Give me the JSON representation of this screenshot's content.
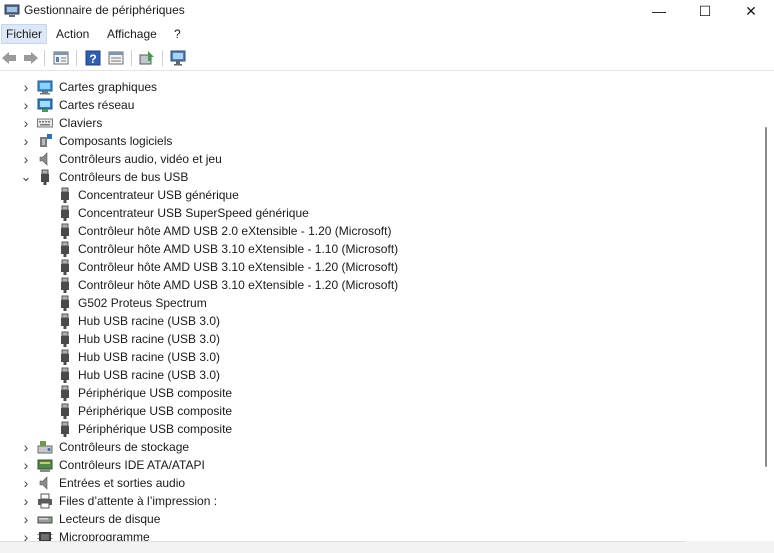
{
  "window": {
    "title": "Gestionnaire de périphériques",
    "minimize_glyph": "—",
    "maximize_glyph": "☐",
    "close_glyph": "✕"
  },
  "menu": [
    {
      "label": "Fichier",
      "active": true
    },
    {
      "label": "Action",
      "active": false
    },
    {
      "label": "Affichage",
      "active": false
    },
    {
      "label": "?",
      "active": false
    }
  ],
  "toolbar": {
    "back_icon": "arrow-left-icon",
    "forward_icon": "arrow-right-icon",
    "buttons": [
      "properties-icon",
      "help-icon",
      "view-icon",
      "update-driver-icon",
      "scan-hardware-icon"
    ]
  },
  "tree": {
    "categories_top": [
      {
        "label": "Cartes graphiques",
        "icon": "display-adapter-icon",
        "expanded": false
      },
      {
        "label": "Cartes réseau",
        "icon": "network-adapter-icon",
        "expanded": false
      },
      {
        "label": "Claviers",
        "icon": "keyboard-icon",
        "expanded": false
      },
      {
        "label": "Composants logiciels",
        "icon": "software-component-icon",
        "expanded": false
      },
      {
        "label": "Contrôleurs audio, vidéo et jeu",
        "icon": "speaker-icon",
        "expanded": false
      },
      {
        "label": "Contrôleurs de bus USB",
        "icon": "usb-icon",
        "expanded": true
      }
    ],
    "usb_children": [
      "Concentrateur USB générique",
      "Concentrateur USB SuperSpeed générique",
      "Contrôleur hôte AMD USB 2.0 eXtensible - 1.20 (Microsoft)",
      "Contrôleur hôte AMD USB 3.10 eXtensible - 1.10 (Microsoft)",
      "Contrôleur hôte AMD USB 3.10 eXtensible - 1.20 (Microsoft)",
      "Contrôleur hôte AMD USB 3.10 eXtensible - 1.20 (Microsoft)",
      "G502 Proteus Spectrum",
      "Hub USB racine (USB 3.0)",
      "Hub USB racine (USB 3.0)",
      "Hub USB racine (USB 3.0)",
      "Hub USB racine (USB 3.0)",
      "Périphérique USB composite",
      "Périphérique USB composite",
      "Périphérique USB composite"
    ],
    "categories_bottom": [
      {
        "label": "Contrôleurs de stockage",
        "icon": "storage-controller-icon",
        "expanded": false
      },
      {
        "label": "Contrôleurs IDE ATA/ATAPI",
        "icon": "ide-controller-icon",
        "expanded": false
      },
      {
        "label": "Entrées et sorties audio",
        "icon": "speaker-icon",
        "expanded": false
      },
      {
        "label": "Files d’attente à l’impression :",
        "icon": "printer-icon",
        "expanded": false
      },
      {
        "label": "Lecteurs de disque",
        "icon": "disk-drive-icon",
        "expanded": false
      },
      {
        "label": "Microprogramme",
        "icon": "firmware-icon",
        "expanded": false
      }
    ]
  },
  "colors": {
    "menu_active_bg": "#dde8f6",
    "scroll_thumb": "#8a8a8a"
  }
}
